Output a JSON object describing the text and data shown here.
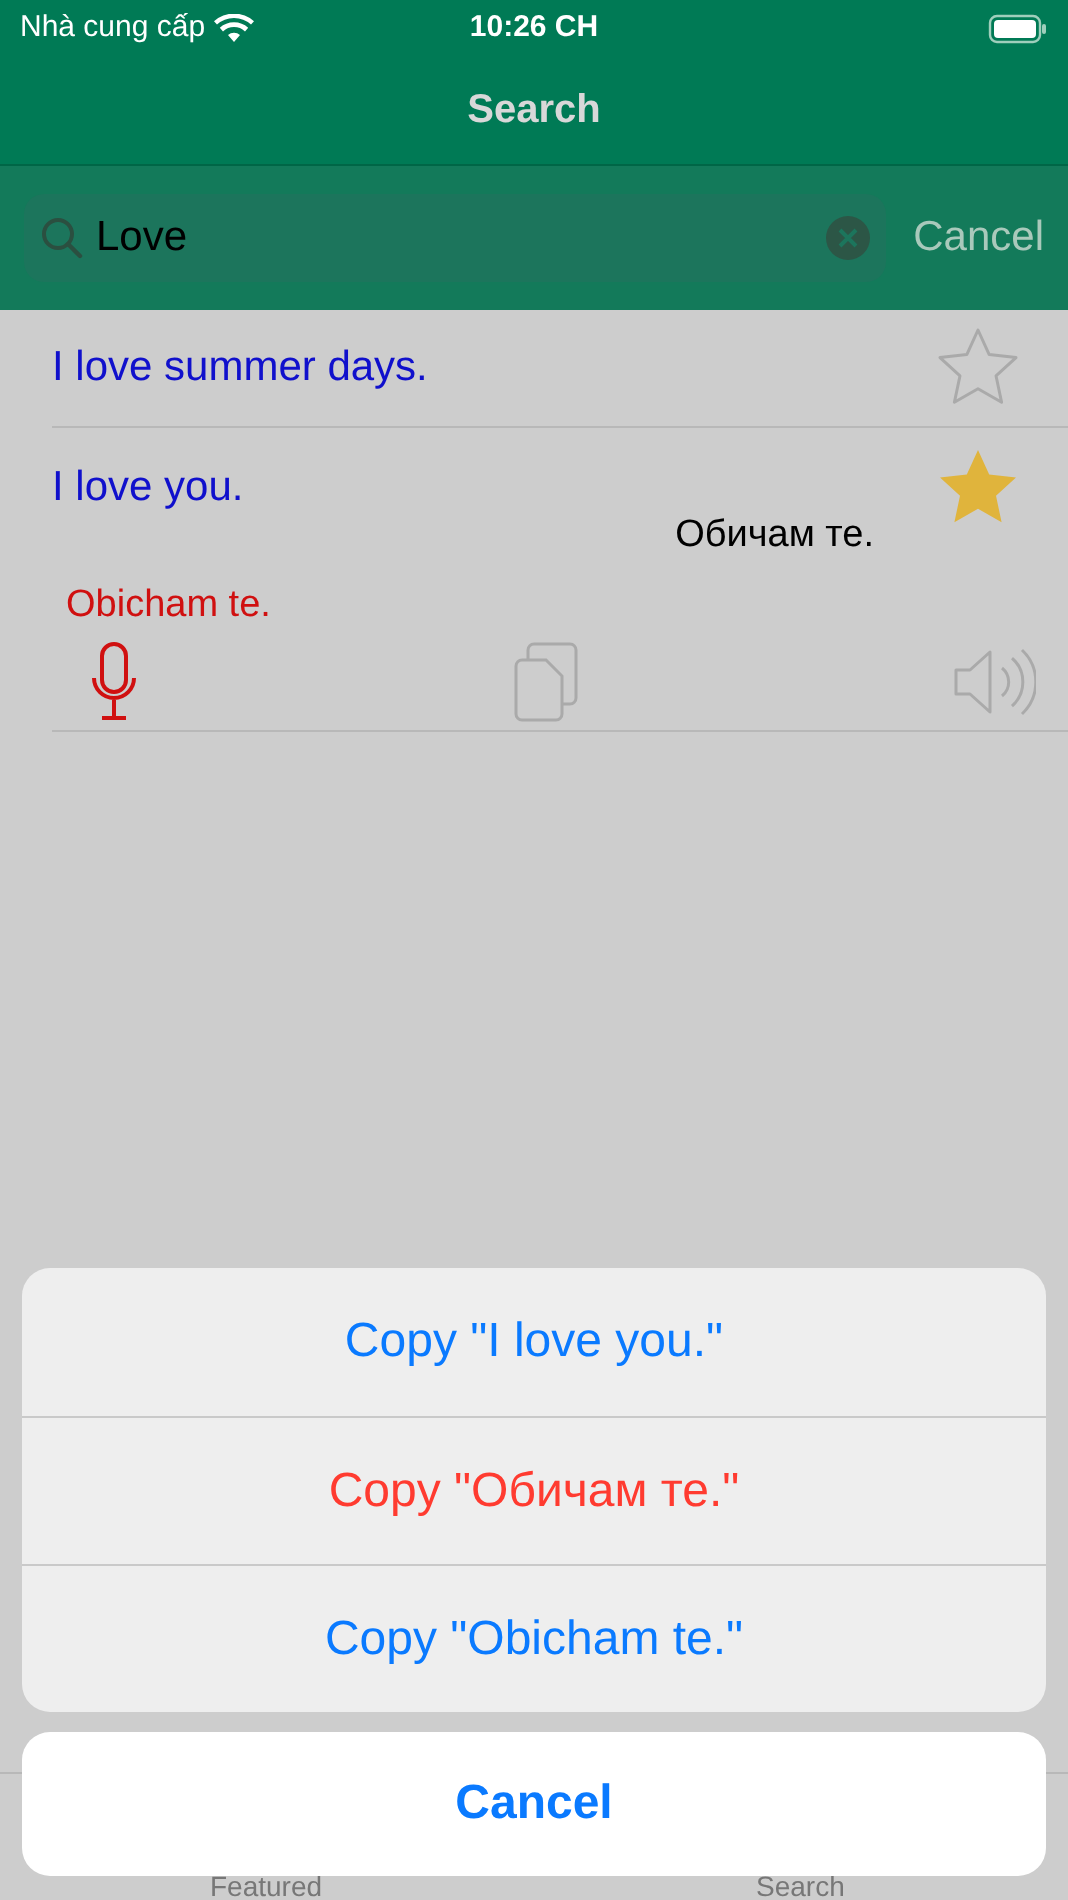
{
  "status_bar": {
    "carrier": "Nhà cung cấp",
    "time": "10:26 CH"
  },
  "nav": {
    "title": "Search"
  },
  "search": {
    "value": "Love",
    "cancel": "Cancel"
  },
  "results": [
    {
      "phrase": "I love summer days.",
      "starred": false,
      "expanded": false
    },
    {
      "phrase": "I love you.",
      "starred": true,
      "expanded": true,
      "translation": "Обичам те.",
      "transliteration": "Obicham te."
    }
  ],
  "tab_bar": {
    "tabs": [
      {
        "label": "Featured"
      },
      {
        "label": "Search"
      }
    ]
  },
  "action_sheet": {
    "actions": [
      {
        "label": "Copy \"I love you.\"",
        "kind": "normal"
      },
      {
        "label": "Copy \"Обичам те.\"",
        "kind": "destructive"
      },
      {
        "label": "Copy \"Obicham te.\"",
        "kind": "normal"
      }
    ],
    "cancel": "Cancel"
  }
}
